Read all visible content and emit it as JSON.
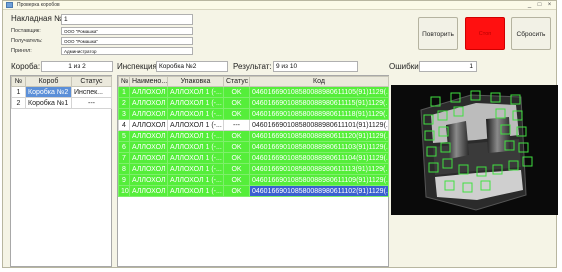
{
  "window": {
    "title": "Проверка коробов"
  },
  "header": {
    "invoice_label": "Накладная №:",
    "invoice_value": "1",
    "supplier_label": "Поставщик:",
    "supplier_value": "ООО \"Ромашка\"",
    "recipient_label": "Получатель:",
    "recipient_value": "ООО \"Ромашка\"",
    "accepted_label": "Принял:",
    "accepted_value": "Администратор"
  },
  "buttons": {
    "repeat": "Повторить",
    "stop": "Стоп",
    "reset": "Сбросить"
  },
  "status_bar": {
    "box_label": "Короба:",
    "box_value": "1 из 2",
    "inspection_label": "Инспекция:",
    "inspection_value": "Коробка №2",
    "result_label": "Результат:",
    "result_value": "9 из 10",
    "errors_label": "Ошибки:",
    "errors_value": "1"
  },
  "boxes_table": {
    "columns": [
      "№",
      "Короб",
      "Статус"
    ],
    "rows": [
      {
        "num": "1",
        "box": "Коробка №2",
        "status": "Инспек..."
      },
      {
        "num": "2",
        "box": "Коробка №1",
        "status": "---"
      }
    ]
  },
  "items_table": {
    "columns": [
      "№",
      "Наимено...",
      "Упаковка",
      "Статус",
      "Код"
    ],
    "rows": [
      {
        "num": "1",
        "name": "АЛЛОХОЛ ...",
        "pack": "АЛЛОХОЛ 1 (-...",
        "status": "OK",
        "code": "046016690108580088980611105(91)1129(...",
        "state": "ok"
      },
      {
        "num": "2",
        "name": "АЛЛОХОЛ ...",
        "pack": "АЛЛОХОЛ 1 (-...",
        "status": "OK",
        "code": "046016690108580088980611115(91)1129(...",
        "state": "ok"
      },
      {
        "num": "3",
        "name": "АЛЛОХОЛ ...",
        "pack": "АЛЛОХОЛ 1 (-...",
        "status": "OK",
        "code": "046016690108580088980611118(91)1129(...",
        "state": "ok"
      },
      {
        "num": "4",
        "name": "АЛЛОХОЛ ...",
        "pack": "АЛЛОХОЛ 1 (-...",
        "status": "---",
        "code": "046016690108580088980611101(91)1129(...",
        "state": "white"
      },
      {
        "num": "5",
        "name": "АЛЛОХОЛ ...",
        "pack": "АЛЛОХОЛ 1 (-...",
        "status": "OK",
        "code": "046016690108580088980611120(91)1129(...",
        "state": "ok"
      },
      {
        "num": "6",
        "name": "АЛЛОХОЛ ...",
        "pack": "АЛЛОХОЛ 1 (-...",
        "status": "OK",
        "code": "046016690108580088980611103(91)1129(...",
        "state": "ok"
      },
      {
        "num": "7",
        "name": "АЛЛОХОЛ ...",
        "pack": "АЛЛОХОЛ 1 (-...",
        "status": "OK",
        "code": "046016690108580088980611104(91)1129(...",
        "state": "ok"
      },
      {
        "num": "8",
        "name": "АЛЛОХОЛ ...",
        "pack": "АЛЛОХОЛ 1 (-...",
        "status": "OK",
        "code": "046016690108580088980611113(91)1129(...",
        "state": "ok"
      },
      {
        "num": "9",
        "name": "АЛЛОХОЛ ...",
        "pack": "АЛЛОХОЛ 1 (-...",
        "status": "OK",
        "code": "046016690108580088980611109(91)1129(...",
        "state": "ok"
      },
      {
        "num": "10",
        "name": "АЛЛОХОЛ ...",
        "pack": "АЛЛОХОЛ 1 (-...",
        "status": "OK",
        "code": "046016690108580088980611102(91)1129(...",
        "state": "ok-selected"
      }
    ]
  },
  "colors": {
    "ok": "#55ee3a",
    "stop": "#ff1010",
    "selection": "#3a60d0",
    "detection": "#40e040"
  },
  "camera": {
    "icon": "camera-feed",
    "detections": 28
  }
}
